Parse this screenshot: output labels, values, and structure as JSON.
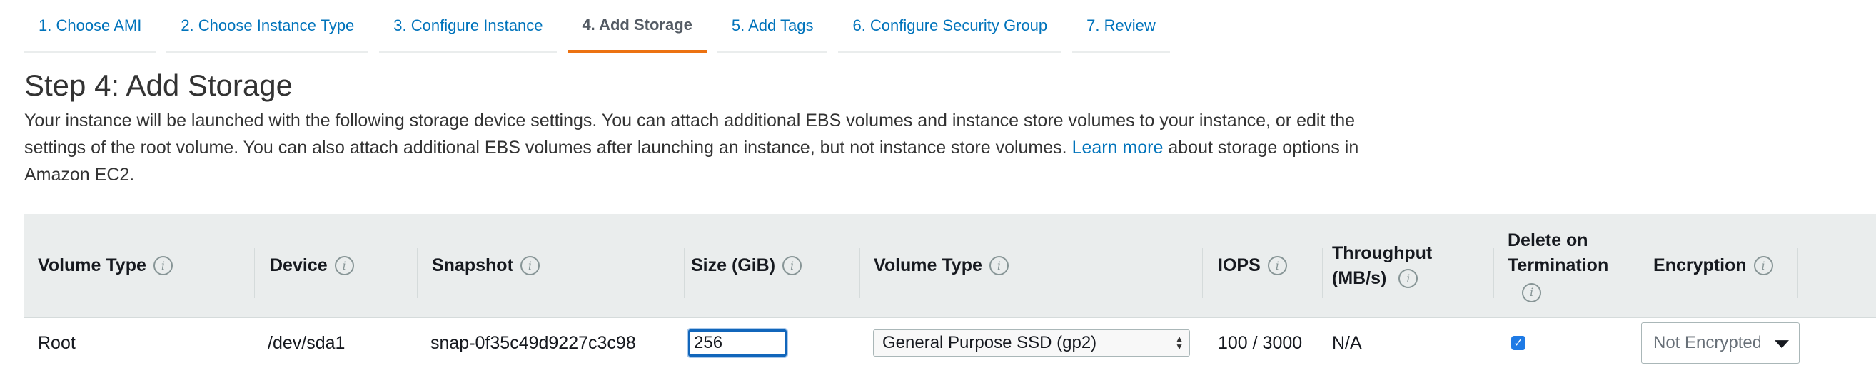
{
  "wizard": {
    "tabs": [
      {
        "label": "1. Choose AMI",
        "active": false
      },
      {
        "label": "2. Choose Instance Type",
        "active": false
      },
      {
        "label": "3. Configure Instance",
        "active": false
      },
      {
        "label": "4. Add Storage",
        "active": true
      },
      {
        "label": "5. Add Tags",
        "active": false
      },
      {
        "label": "6. Configure Security Group",
        "active": false
      },
      {
        "label": "7. Review",
        "active": false
      }
    ],
    "active_color": "#ec7211",
    "link_color": "#0073bb"
  },
  "page": {
    "title": "Step 4: Add Storage",
    "description_before": "Your instance will be launched with the following storage device settings. You can attach additional EBS volumes and instance store volumes to your instance, or edit the settings of the root volume. You can also attach additional EBS volumes after launching an instance, but not instance store volumes.",
    "learn_more": "Learn more",
    "description_after": "about storage options in Amazon EC2."
  },
  "table": {
    "headers": {
      "volume_type": "Volume Type",
      "device": "Device",
      "snapshot": "Snapshot",
      "size": "Size (GiB)",
      "volume_type_2": "Volume Type",
      "iops": "IOPS",
      "throughput_line1": "Throughput",
      "throughput_line2": "(MB/s)",
      "delete_line1": "Delete on",
      "delete_line2": "Termination",
      "encryption": "Encryption"
    },
    "info_icon": "info-icon",
    "rows": [
      {
        "volume_type": "Root",
        "device": "/dev/sda1",
        "snapshot": "snap-0f35c49d9227c3c98",
        "size": "256",
        "ebs_volume_type": "General Purpose SSD (gp2)",
        "iops": "100 / 3000",
        "throughput": "N/A",
        "delete_on_termination": true,
        "encryption": "Not Encrypted"
      }
    ]
  }
}
